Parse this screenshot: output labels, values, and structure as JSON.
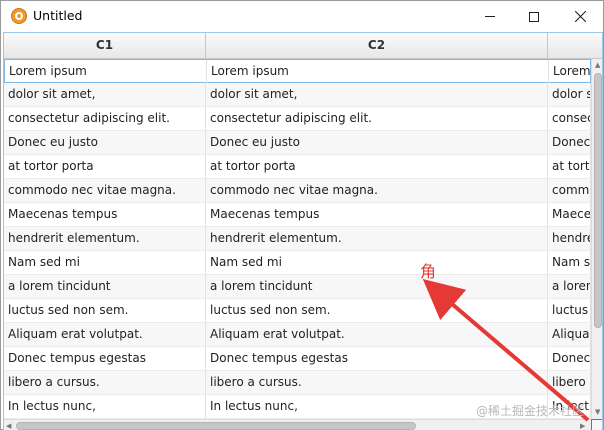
{
  "window": {
    "title": "Untitled",
    "icon": "app-icon"
  },
  "table": {
    "columns": [
      "C1",
      "C2",
      ""
    ],
    "rows": [
      [
        "Lorem ipsum",
        "Lorem ipsum",
        "Lorem"
      ],
      [
        "dolor sit amet,",
        "dolor sit amet,",
        "dolor s"
      ],
      [
        "consectetur adipiscing elit.",
        "consectetur adipiscing elit.",
        "consect"
      ],
      [
        "Donec eu justo",
        "Donec eu justo",
        "Donec"
      ],
      [
        "at tortor porta",
        "at tortor porta",
        "at torto"
      ],
      [
        "commodo nec vitae magna.",
        "commodo nec vitae magna.",
        "commo"
      ],
      [
        "Maecenas tempus",
        "Maecenas tempus",
        "Maece"
      ],
      [
        "hendrerit elementum.",
        "hendrerit elementum.",
        "hendre"
      ],
      [
        "Nam sed mi",
        "Nam sed mi",
        "Nam se"
      ],
      [
        "a lorem tincidunt",
        "a lorem tincidunt",
        "a loren"
      ],
      [
        "luctus sed non sem.",
        "luctus sed non sem.",
        "luctus"
      ],
      [
        "Aliquam erat volutpat.",
        "Aliquam erat volutpat.",
        "Aliqua"
      ],
      [
        "Donec tempus egestas",
        "Donec tempus egestas",
        "Donec"
      ],
      [
        "libero a cursus.",
        "libero a cursus.",
        "libero a"
      ],
      [
        "In lectus nunc,",
        "In lectus nunc,",
        "In lectu"
      ]
    ]
  },
  "annotation": {
    "label": "角",
    "color": "#e53935"
  },
  "watermark": "@稀土掘金技术社区",
  "colors": {
    "selection_border": "#7db8e6",
    "corner_highlight": "#e84040"
  }
}
